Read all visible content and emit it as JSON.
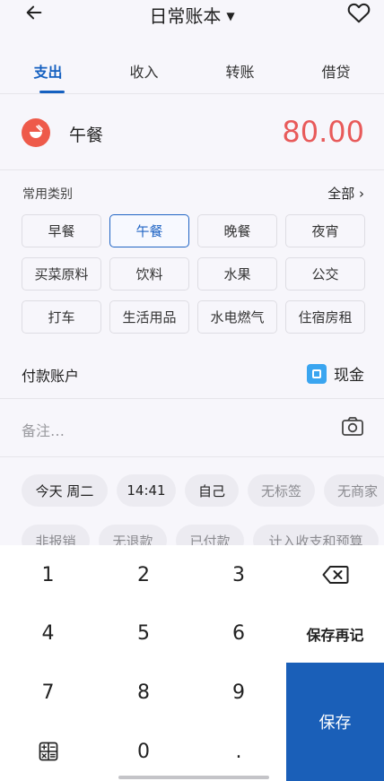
{
  "header": {
    "title": "日常账本",
    "back_icon": "arrow-left-icon",
    "favorite_icon": "heart-outline-icon"
  },
  "tabs": [
    {
      "label": "支出",
      "active": true
    },
    {
      "label": "收入",
      "active": false
    },
    {
      "label": "转账",
      "active": false
    },
    {
      "label": "借贷",
      "active": false
    }
  ],
  "entry": {
    "category": "午餐",
    "amount": "80.00",
    "category_icon": "bowl-icon",
    "amount_color": "#e85a5a"
  },
  "common": {
    "label": "常用类别",
    "all_label": "全部",
    "chips": [
      "早餐",
      "午餐",
      "晚餐",
      "夜宵",
      "买菜原料",
      "饮料",
      "水果",
      "公交",
      "打车",
      "生活用品",
      "水电燃气",
      "住宿房租"
    ],
    "selected": "午餐"
  },
  "payment": {
    "label": "付款账户",
    "account": "现金",
    "account_icon": "wallet-icon"
  },
  "note": {
    "placeholder": "备注…",
    "camera_icon": "camera-icon"
  },
  "tags_row1": [
    "今天 周二",
    "14:41",
    "自己",
    "无标签",
    "无商家"
  ],
  "tags_row2": [
    "非报销",
    "无退款",
    "已付款",
    "计入收支和预算"
  ],
  "keypad": {
    "keys": [
      "1",
      "2",
      "3",
      "4",
      "5",
      "6",
      "7",
      "8",
      "9",
      "0",
      "."
    ],
    "save_again": "保存再记",
    "save": "保存",
    "backspace_icon": "backspace-icon",
    "calculator_icon": "calculator-icon"
  },
  "colors": {
    "accent": "#1560c0",
    "save_button": "#1a5fb8",
    "expense": "#e85a5a"
  }
}
